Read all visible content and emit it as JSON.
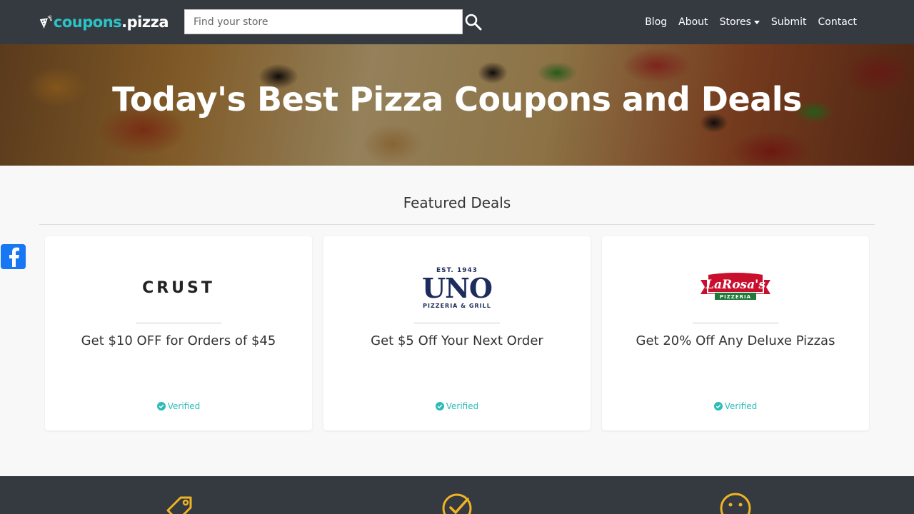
{
  "nav": {
    "logo_part1": "coupons",
    "logo_part2": ".pizza",
    "search_placeholder": "Find your store",
    "links": [
      "Blog",
      "About",
      "Stores",
      "Submit",
      "Contact"
    ]
  },
  "hero": {
    "title": "Today's Best Pizza Coupons and Deals"
  },
  "featured": {
    "title": "Featured Deals",
    "cards": [
      {
        "brand": "CRUST",
        "deal": "Get $10 OFF for Orders of $45",
        "status": "Verified"
      },
      {
        "brand_est": "EST. 1943",
        "brand": "UNO",
        "brand_sub": "PIZZERIA & GRILL",
        "deal": "Get $5 Off Your Next Order",
        "status": "Verified"
      },
      {
        "brand": "LaRosa's",
        "brand_sub": "PIZZERIA",
        "deal": "Get 20% Off Any Deluxe Pizzas",
        "status": "Verified"
      }
    ]
  },
  "colors": {
    "nav_bg": "#343a40",
    "accent_teal": "#2cc4c7",
    "icon_gold": "#f0b323",
    "facebook": "#1877f2"
  },
  "icons": [
    "tag-icon",
    "check-circle-icon",
    "smile-icon"
  ]
}
